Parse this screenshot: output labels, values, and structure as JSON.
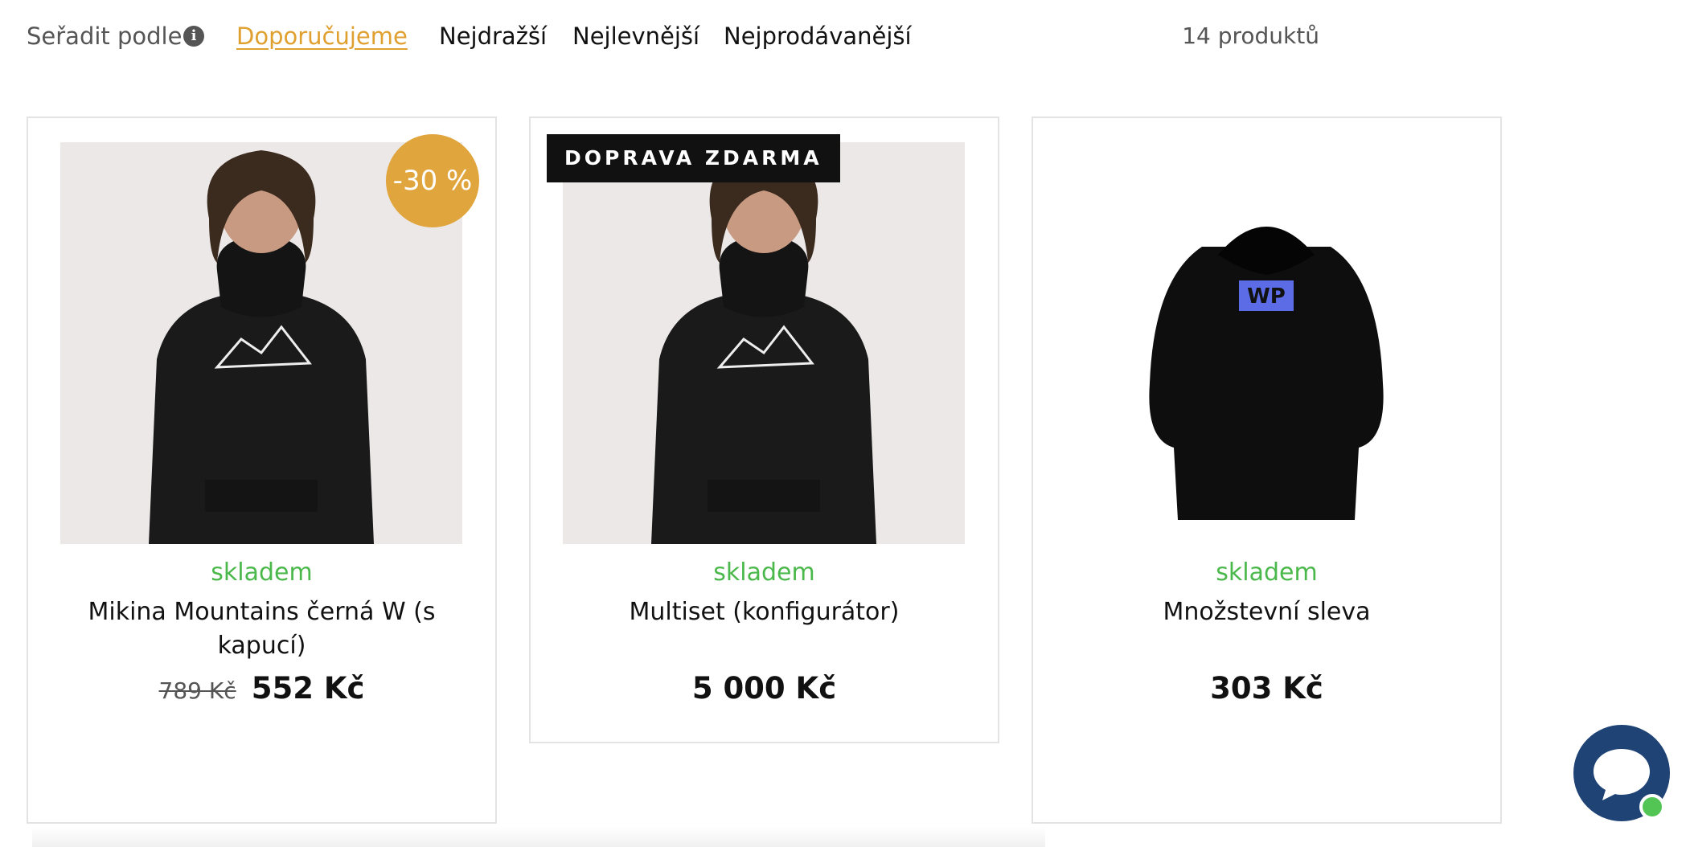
{
  "sort": {
    "label": "Seřadit podle",
    "options": [
      "Doporučujeme",
      "Nejdražší",
      "Nejlevnější",
      "Nejprodávanější"
    ],
    "active": "Doporučujeme"
  },
  "product_count": "14 produktů",
  "products": [
    {
      "badge": "-30 %",
      "stock": "skladem",
      "name": "Mikina Mountains černá W (s kapucí)",
      "old_price": "789 Kč",
      "price": "552 Kč"
    },
    {
      "badge": "DOPRAVA ZDARMA",
      "stock": "skladem",
      "name": "Multiset (konfigurátor)",
      "price": "5 000 Kč"
    },
    {
      "stock": "skladem",
      "name": "Množstevní sleva",
      "price": "303 Kč",
      "print_text": "WP"
    }
  ],
  "colors": {
    "accent": "#e0a030",
    "discount_badge": "#e0a53c",
    "in_stock": "#4bb84b",
    "chat": "#1f4375",
    "online_dot": "#52c554"
  },
  "icons": [
    "info-icon",
    "chat-icon"
  ]
}
